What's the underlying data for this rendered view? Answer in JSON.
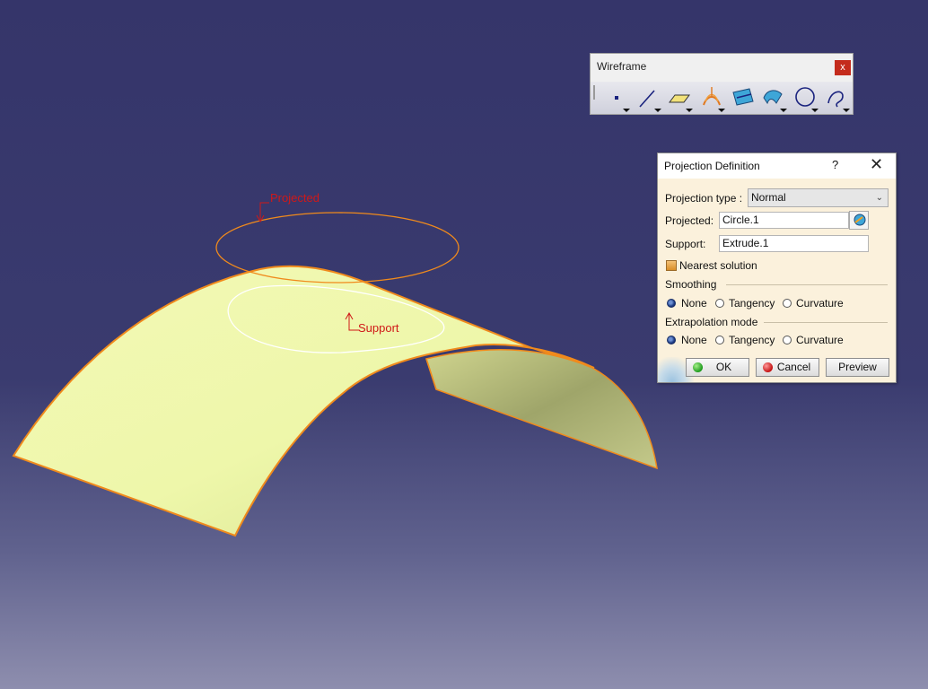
{
  "viewport": {
    "annotations": {
      "projected_label": "Projected",
      "support_label": "Support"
    },
    "colors": {
      "surface_fill": "#eef6a8",
      "surface_edge": "#f08a1c",
      "circle_projected": "#f08a1c",
      "curve_result": "#ffffff",
      "annotation": "#d01818"
    }
  },
  "toolbar": {
    "title": "Wireframe",
    "close_label": "x",
    "tools": [
      {
        "name": "point-icon"
      },
      {
        "name": "line-icon"
      },
      {
        "name": "plane-icon"
      },
      {
        "name": "projection-icon"
      },
      {
        "name": "intersection-icon"
      },
      {
        "name": "parallel-curve-icon"
      },
      {
        "name": "circle-icon"
      },
      {
        "name": "spline-icon"
      }
    ]
  },
  "dialog": {
    "title": "Projection Definition",
    "help": "?",
    "close": "✕",
    "projection_type_label": "Projection type :",
    "projection_type_value": "Normal",
    "projected_label": "Projected:",
    "projected_value": "Circle.1",
    "support_label": "Support:",
    "support_value": "Extrude.1",
    "nearest_solution_label": "Nearest solution",
    "nearest_solution_checked": true,
    "smoothing": {
      "label": "Smoothing",
      "options": [
        "None",
        "Tangency",
        "Curvature"
      ],
      "selected": "None"
    },
    "extrapolation": {
      "label": "Extrapolation mode",
      "options": [
        "None",
        "Tangency",
        "Curvature"
      ],
      "selected": "None"
    },
    "buttons": {
      "ok": "OK",
      "cancel": "Cancel",
      "preview": "Preview"
    }
  }
}
